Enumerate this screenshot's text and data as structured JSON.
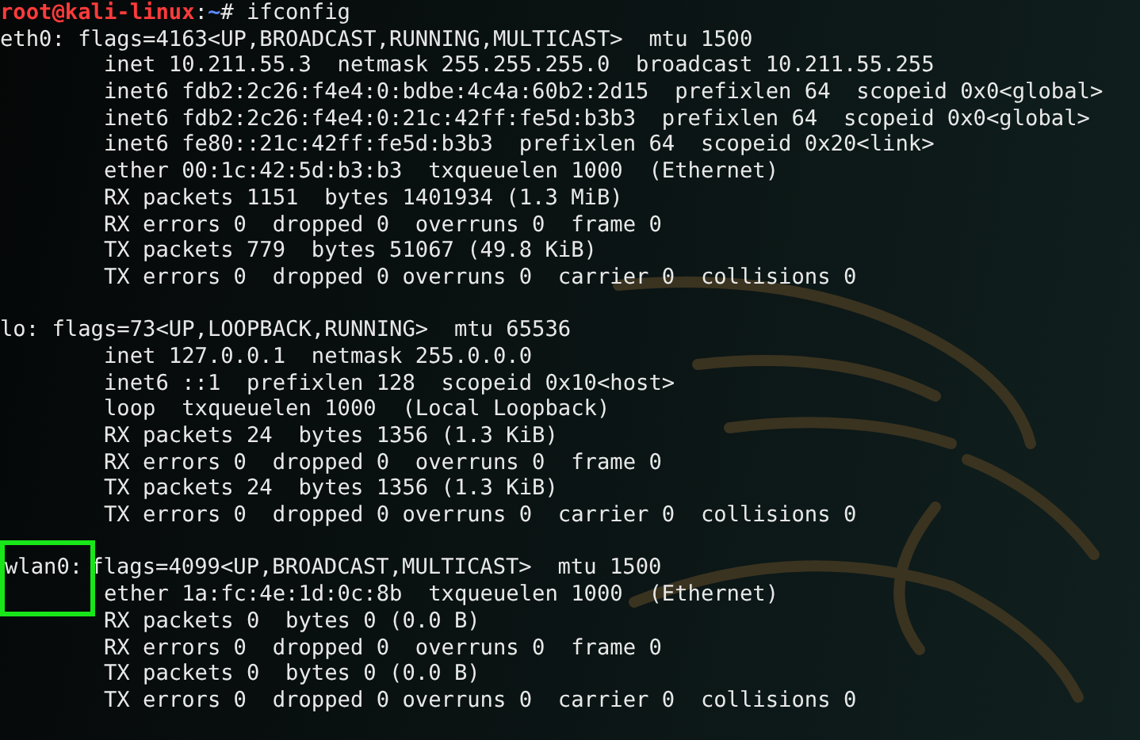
{
  "prompt": {
    "user": "root@kali-linux",
    "separator": ":",
    "path": "~",
    "symbol": "#",
    "command": "ifconfig"
  },
  "interfaces": [
    {
      "name": "eth0:",
      "highlighted": false,
      "flags": "flags=4163<UP,BROADCAST,RUNNING,MULTICAST>  mtu 1500",
      "lines": [
        "inet 10.211.55.3  netmask 255.255.255.0  broadcast 10.211.55.255",
        "inet6 fdb2:2c26:f4e4:0:bdbe:4c4a:60b2:2d15  prefixlen 64  scopeid 0x0<global>",
        "inet6 fdb2:2c26:f4e4:0:21c:42ff:fe5d:b3b3  prefixlen 64  scopeid 0x0<global>",
        "inet6 fe80::21c:42ff:fe5d:b3b3  prefixlen 64  scopeid 0x20<link>",
        "ether 00:1c:42:5d:b3:b3  txqueuelen 1000  (Ethernet)",
        "RX packets 1151  bytes 1401934 (1.3 MiB)",
        "RX errors 0  dropped 0  overruns 0  frame 0",
        "TX packets 779  bytes 51067 (49.8 KiB)",
        "TX errors 0  dropped 0 overruns 0  carrier 0  collisions 0"
      ]
    },
    {
      "name": "lo:",
      "highlighted": false,
      "flags": "flags=73<UP,LOOPBACK,RUNNING>  mtu 65536",
      "lines": [
        "inet 127.0.0.1  netmask 255.0.0.0",
        "inet6 ::1  prefixlen 128  scopeid 0x10<host>",
        "loop  txqueuelen 1000  (Local Loopback)",
        "RX packets 24  bytes 1356 (1.3 KiB)",
        "RX errors 0  dropped 0  overruns 0  frame 0",
        "TX packets 24  bytes 1356 (1.3 KiB)",
        "TX errors 0  dropped 0 overruns 0  carrier 0  collisions 0"
      ]
    },
    {
      "name": "wlan0:",
      "highlighted": true,
      "flags": "flags=4099<UP,BROADCAST,MULTICAST>  mtu 1500",
      "lines": [
        "ether 1a:fc:4e:1d:0c:8b  txqueuelen 1000  (Ethernet)",
        "RX packets 0  bytes 0 (0.0 B)",
        "RX errors 0  dropped 0  overruns 0  frame 0",
        "TX packets 0  bytes 0 (0.0 B)",
        "TX errors 0  dropped 0 overruns 0  carrier 0  collisions 0"
      ]
    }
  ]
}
